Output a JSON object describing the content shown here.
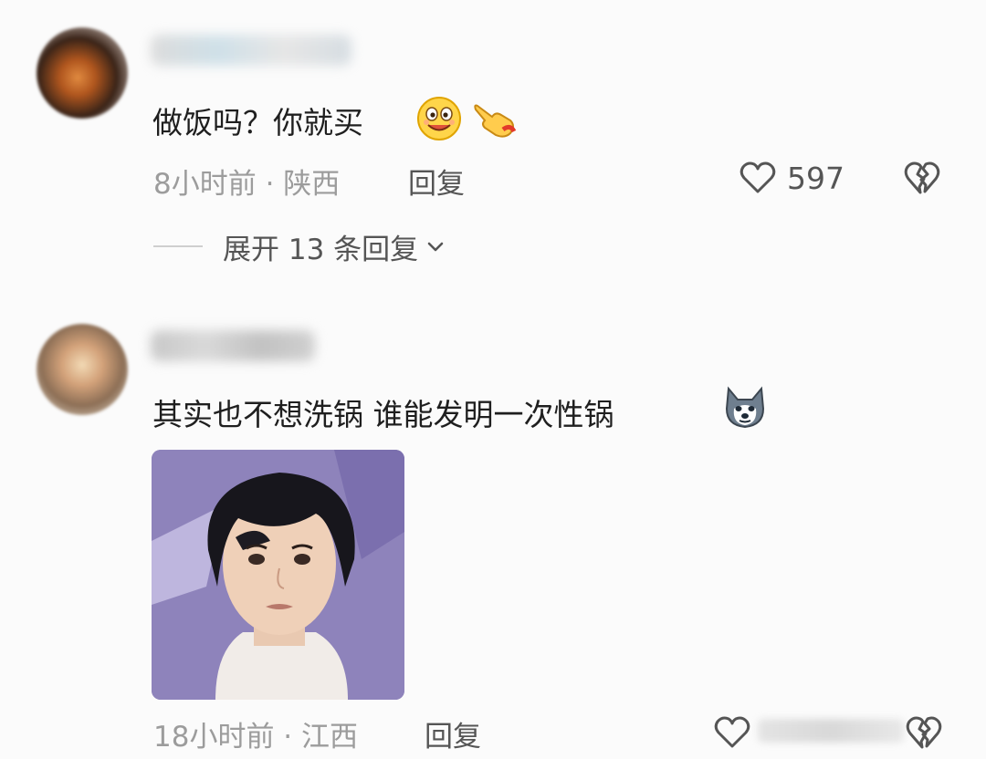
{
  "comments": [
    {
      "username": "",
      "text": "做饭吗？你就买",
      "time": "8小时前 · 陕西",
      "reply_label": "回复",
      "like_count": "597",
      "expand_label": "展开 13 条回复",
      "emojis": [
        "grinning-face-emoji",
        "pointing-hand-emoji"
      ]
    },
    {
      "username": "",
      "text": "其实也不想洗锅 谁能发明一次性锅",
      "time": "18小时前 · 江西",
      "reply_label": "回复",
      "emojis": [
        "husky-dog-emoji"
      ],
      "image": "reaction-photo"
    }
  ],
  "icons": {
    "like": "heart-icon",
    "dislike": "broken-heart-icon",
    "expand": "chevron-down-icon"
  },
  "colors": {
    "background": "#fbfbfb",
    "text_primary": "#1f1f1f",
    "text_secondary": "#9c9c9c",
    "text_action": "#555555",
    "image_bg": "#8a7fb6"
  }
}
